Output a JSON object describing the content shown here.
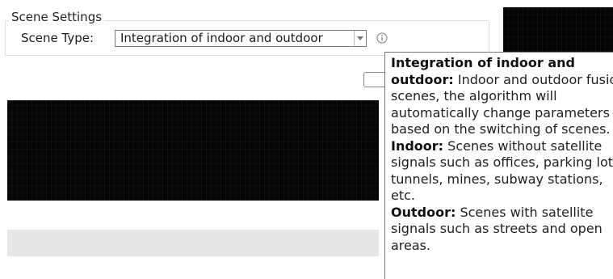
{
  "scene_settings": {
    "group_title": "Scene Settings",
    "scene_type_label": "Scene Type:",
    "scene_type_value": "Integration of indoor and outdoor",
    "info_icon": "info-circle-icon",
    "dropdown_icon": "chevron-down-icon"
  },
  "tooltip": {
    "integration_title": "Integration of indoor and outdoor:",
    "integration_text": " Indoor and outdoor fusion scenes, the algorithm will automatically change parameters based on the switching of scenes.",
    "indoor_title": "Indoor:",
    "indoor_text": " Scenes without satellite signals such as offices, parking lots, tunnels, mines, subway stations, etc.",
    "outdoor_title": "Outdoor:",
    "outdoor_text": " Scenes with satellite signals such as streets and open areas."
  },
  "colors": {
    "dark_panel": "#050505",
    "gray_bar": "#e6e6e6",
    "tooltip_border": "#767676"
  }
}
